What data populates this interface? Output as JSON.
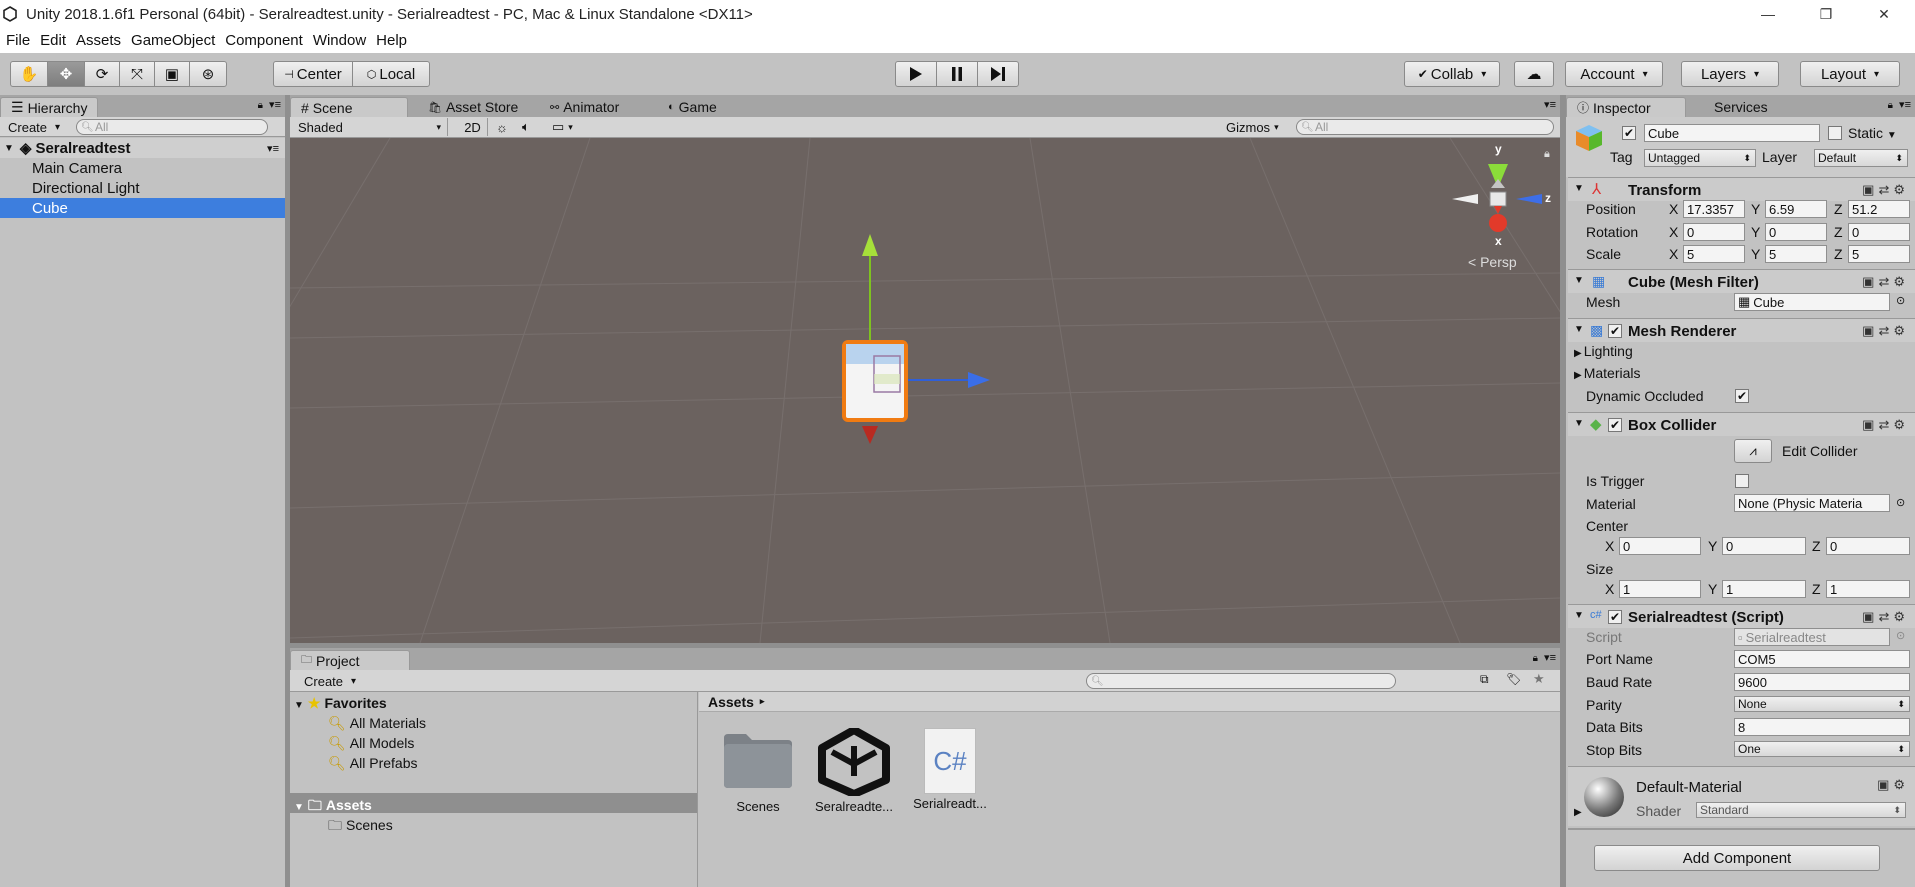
{
  "window": {
    "title": "Unity 2018.1.6f1 Personal (64bit) - Seralreadtest.unity - Serialreadtest - PC, Mac & Linux Standalone <DX11>",
    "minimize": "—",
    "maximize": "❐",
    "close": "✕"
  },
  "menu": [
    "File",
    "Edit",
    "Assets",
    "GameObject",
    "Component",
    "Window",
    "Help"
  ],
  "toolbar": {
    "center": "Center",
    "local": "Local",
    "collab": "Collab",
    "account": "Account",
    "layers": "Layers",
    "layout": "Layout"
  },
  "hierarchy": {
    "tab": "Hierarchy",
    "create": "Create",
    "search_placeholder": "All",
    "scene": "Seralreadtest",
    "items": [
      "Main Camera",
      "Directional Light",
      "Cube"
    ]
  },
  "scene_view": {
    "tabs": [
      "Scene",
      "Asset Store",
      "Animator",
      "Game"
    ],
    "shading": "Shaded",
    "mode_2d": "2D",
    "gizmos": "Gizmos",
    "search_placeholder": "All",
    "persp": "Persp",
    "axis_y": "y",
    "axis_z": "z",
    "axis_x": "x"
  },
  "project": {
    "tab": "Project",
    "create": "Create",
    "favorites": "Favorites",
    "favorite_items": [
      "All Materials",
      "All Models",
      "All Prefabs"
    ],
    "assets_root": "Assets",
    "asset_folders": [
      "Scenes"
    ],
    "breadcrumb": "Assets",
    "grid_items": [
      "Scenes",
      "Seralreadte...",
      "Serialreadt..."
    ],
    "cs_label": "C#"
  },
  "inspector": {
    "tabs": [
      "Inspector",
      "Services"
    ],
    "object_name": "Cube",
    "static_label": "Static",
    "tag_label": "Tag",
    "tag_value": "Untagged",
    "layer_label": "Layer",
    "layer_value": "Default",
    "transform": {
      "title": "Transform",
      "position_label": "Position",
      "rotation_label": "Rotation",
      "scale_label": "Scale",
      "position": [
        "17.3357",
        "6.59",
        "51.2"
      ],
      "rotation": [
        "0",
        "0",
        "0"
      ],
      "scale": [
        "5",
        "5",
        "5"
      ],
      "x": "X",
      "y": "Y",
      "z": "Z"
    },
    "mesh_filter": {
      "title": "Cube (Mesh Filter)",
      "mesh_label": "Mesh",
      "mesh_value": "Cube"
    },
    "mesh_renderer": {
      "title": "Mesh Renderer",
      "lighting": "Lighting",
      "materials": "Materials",
      "dynamic_occluded": "Dynamic Occluded"
    },
    "box_collider": {
      "title": "Box Collider",
      "edit_collider": "Edit Collider",
      "is_trigger": "Is Trigger",
      "material_label": "Material",
      "material_value": "None (Physic Materia",
      "center_label": "Center",
      "center": [
        "0",
        "0",
        "0"
      ],
      "size_label": "Size",
      "size": [
        "1",
        "1",
        "1"
      ]
    },
    "script": {
      "title": "Serialreadtest (Script)",
      "script_label": "Script",
      "script_value": "Serialreadtest",
      "port_name_label": "Port Name",
      "port_name": "COM5",
      "baud_rate_label": "Baud Rate",
      "baud_rate": "9600",
      "parity_label": "Parity",
      "parity": "None",
      "data_bits_label": "Data Bits",
      "data_bits": "8",
      "stop_bits_label": "Stop Bits",
      "stop_bits": "One"
    },
    "material": {
      "name": "Default-Material",
      "shader_label": "Shader",
      "shader_value": "Standard"
    },
    "add_component": "Add Component"
  }
}
